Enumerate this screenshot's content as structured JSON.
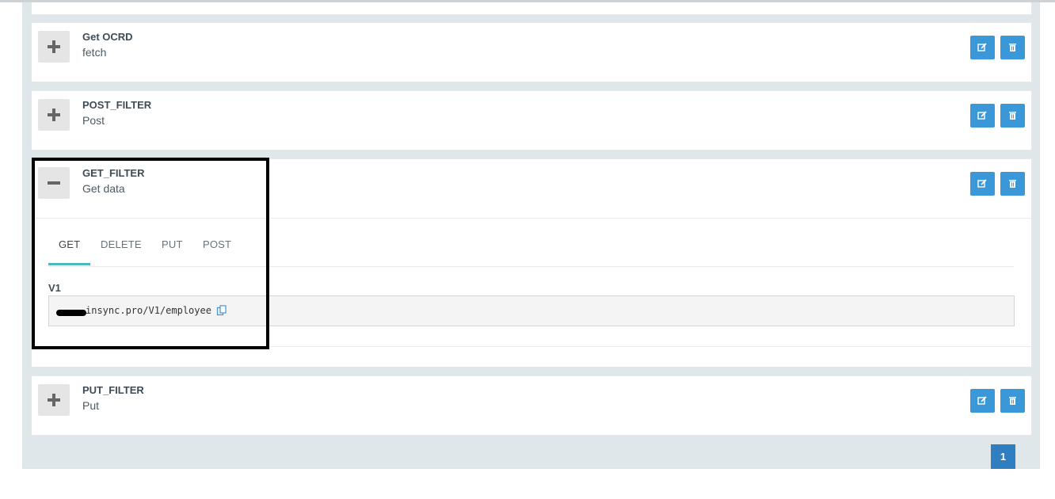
{
  "cards": [
    {
      "title": "Get OCRD",
      "subtitle": "fetch",
      "toggle_icon": "plus-icon"
    },
    {
      "title": "POST_FILTER",
      "subtitle": "Post",
      "toggle_icon": "plus-icon"
    },
    {
      "title": "GET_FILTER",
      "subtitle": "Get data",
      "toggle_icon": "minus-icon"
    },
    {
      "title": "PUT_FILTER",
      "subtitle": "Put",
      "toggle_icon": "plus-icon"
    }
  ],
  "expanded": {
    "tabs": [
      "GET",
      "DELETE",
      "PUT",
      "POST"
    ],
    "active_tab": "GET",
    "version_label": "V1",
    "url_text": "insync.pro/V1/employee"
  },
  "pagination": {
    "current_page": "1"
  },
  "colors": {
    "accent": "#3a97d8",
    "tab_underline": "#4cb8c4",
    "page_active": "#2e7ec0"
  }
}
